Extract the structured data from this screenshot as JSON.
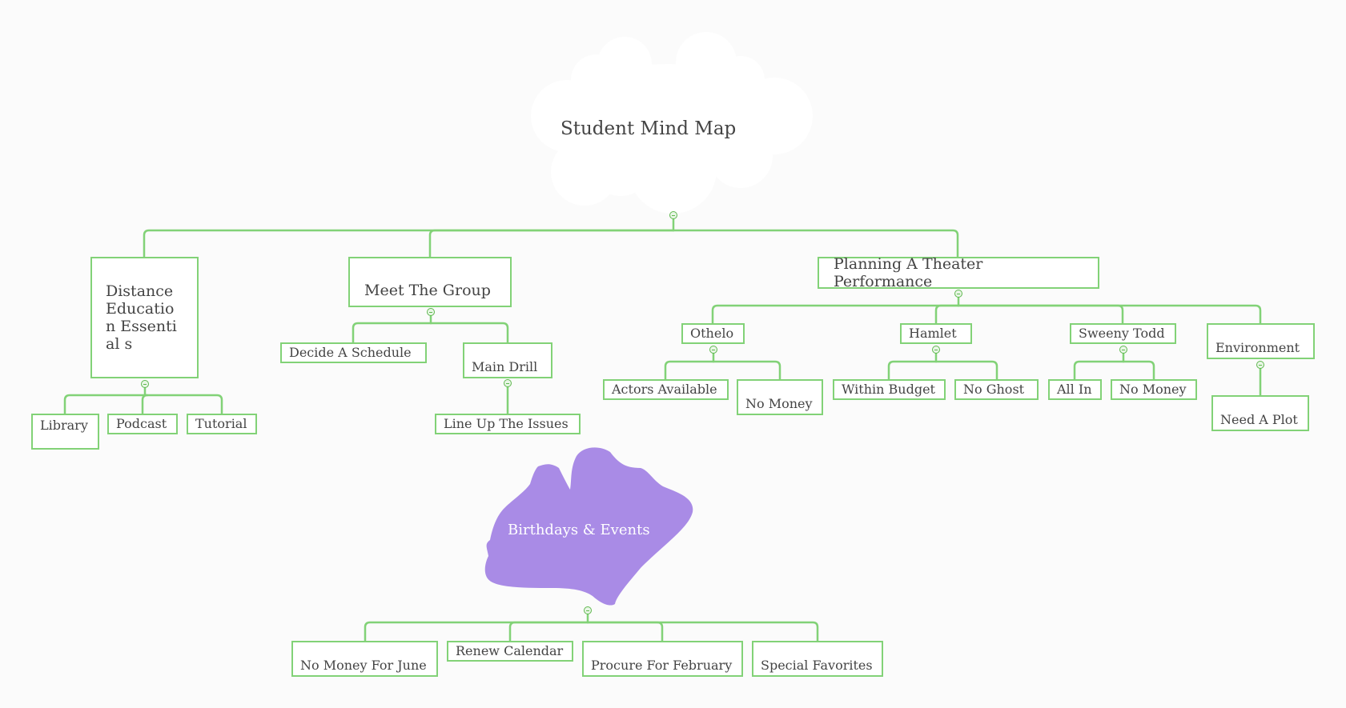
{
  "root": {
    "title": "Student Mind Map",
    "shape": "cloud",
    "fill": "#ffffff"
  },
  "colors": {
    "line": "#82d277",
    "collapse": "#5fb84f",
    "floating_fill": "#a98be6",
    "text": "#444444",
    "background": "#fbfbfb"
  },
  "branches": [
    {
      "label": "Distance Education Essentials",
      "display": "Distance Educatio n Essential s",
      "children": [
        {
          "label": "Library"
        },
        {
          "label": "Podcast"
        },
        {
          "label": "Tutorial"
        }
      ]
    },
    {
      "label": "Meet The Group",
      "children": [
        {
          "label": "Decide A Schedule"
        },
        {
          "label": "Main Drill",
          "children": [
            {
              "label": "Line Up The Issues"
            }
          ]
        }
      ]
    },
    {
      "label": "Planning A Theater Performance",
      "children": [
        {
          "label": "Othelo",
          "children": [
            {
              "label": "Actors Available"
            },
            {
              "label": "No Money"
            }
          ]
        },
        {
          "label": "Hamlet",
          "children": [
            {
              "label": "Within Budget"
            },
            {
              "label": "No Ghost"
            }
          ]
        },
        {
          "label": "Sweeny Todd",
          "children": [
            {
              "label": "All In"
            },
            {
              "label": "No Money"
            }
          ]
        },
        {
          "label": "Environment",
          "children": [
            {
              "label": "Need A Plot"
            }
          ]
        }
      ]
    }
  ],
  "floating": {
    "title": "Birthdays & Events",
    "shape": "leaf",
    "children": [
      {
        "label": "No Money For June"
      },
      {
        "label": "Renew Calendar"
      },
      {
        "label": "Procure For February"
      },
      {
        "label": "Special Favorites"
      }
    ]
  }
}
